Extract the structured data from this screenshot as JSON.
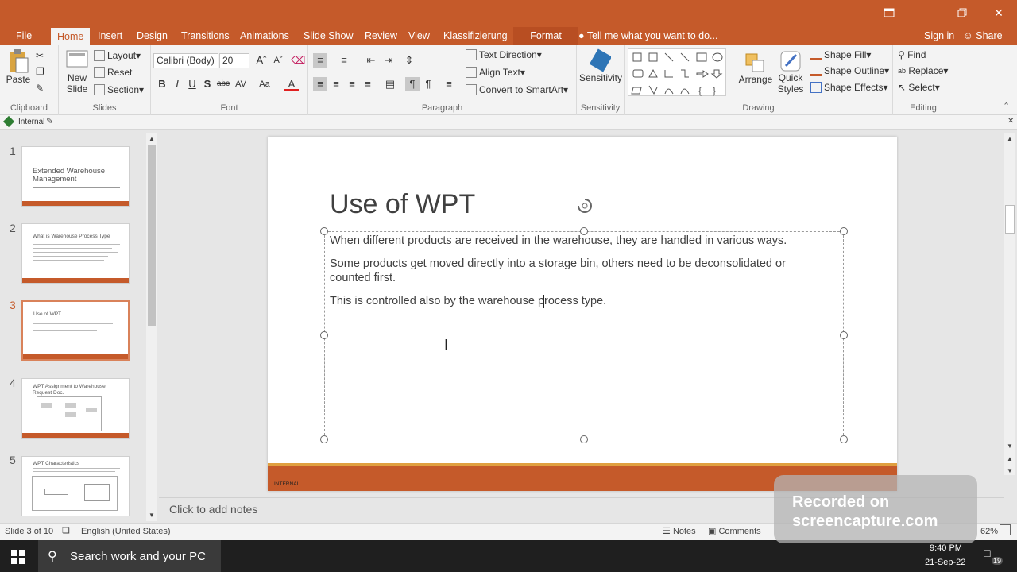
{
  "window": {
    "controls": [
      "ribbon-display",
      "minimize",
      "restore",
      "close"
    ]
  },
  "ribbon_tabs": [
    "File",
    "Home",
    "Insert",
    "Design",
    "Transitions",
    "Animations",
    "Slide Show",
    "Review",
    "View",
    "Klassifizierung",
    "Format"
  ],
  "tell_me": "Tell me what you want to do...",
  "sign_in": "Sign in",
  "share": "Share",
  "clipboard": {
    "paste": "Paste",
    "label": "Clipboard"
  },
  "slides_group": {
    "new_slide": "New",
    "new_slide2": "Slide",
    "layout": "Layout",
    "reset": "Reset",
    "section": "Section",
    "label": "Slides"
  },
  "font_group": {
    "font_name": "Calibri (Body)",
    "font_size": "20",
    "label": "Font"
  },
  "paragraph_group": {
    "text_direction": "Text Direction",
    "align_text": "Align Text",
    "convert": "Convert to SmartArt",
    "label": "Paragraph"
  },
  "sensitivity_group": {
    "button": "Sensitivity",
    "label": "Sensitivity"
  },
  "drawing_group": {
    "arrange": "Arrange",
    "quick_styles": "Quick",
    "quick_styles2": "Styles",
    "shape_fill": "Shape Fill",
    "shape_outline": "Shape Outline",
    "shape_effects": "Shape Effects",
    "label": "Drawing"
  },
  "editing_group": {
    "find": "Find",
    "replace": "Replace",
    "select": "Select",
    "label": "Editing"
  },
  "classification": "Internal",
  "thumbnails": [
    {
      "num": "1",
      "title": "Extended Warehouse Management"
    },
    {
      "num": "2",
      "title": "What is Warehouse Process Type"
    },
    {
      "num": "3",
      "title": "Use of WPT"
    },
    {
      "num": "4",
      "title": "WPT Assignment to Warehouse Request Doc."
    },
    {
      "num": "5",
      "title": "WPT Characteristics"
    }
  ],
  "slide": {
    "title": "Use of WPT",
    "paragraphs": [
      "When different products are received in the warehouse, they are handled in various ways.",
      "Some products get moved directly into a storage bin, others need to be deconsolidated or",
      "counted first.",
      "This is controlled also by the warehouse process type."
    ],
    "footer": "INTERNAL"
  },
  "notes_placeholder": "Click to add notes",
  "status": {
    "slide_of": "Slide 3 of 10",
    "language": "English (United States)",
    "notes": "Notes",
    "comments": "Comments",
    "zoom": "62%"
  },
  "taskbar": {
    "search": "Search work and your PC",
    "time": "9:40 PM",
    "date": "21-Sep-22",
    "notifications": "19"
  },
  "watermark": {
    "line1": "Recorded on",
    "line2": "screencapture.com"
  }
}
